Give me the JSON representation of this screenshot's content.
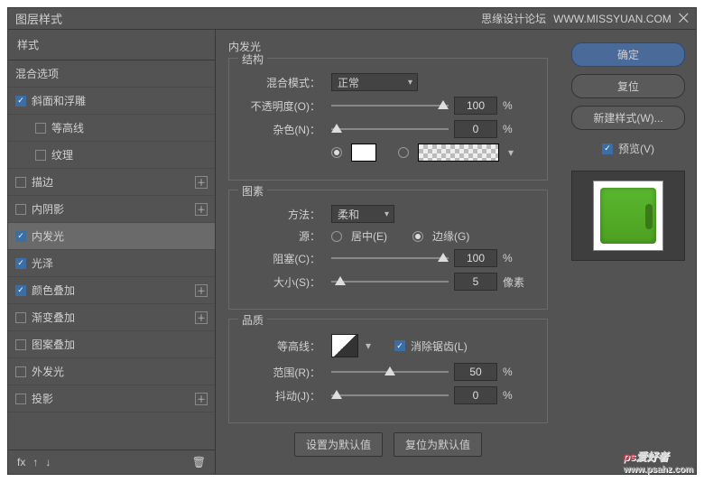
{
  "dialog": {
    "title": "图层样式",
    "watermark_site": "思缘设计论坛",
    "watermark_url": "WWW.MISSYUAN.COM"
  },
  "sidebar": {
    "header": "样式",
    "blend_options": "混合选项",
    "items": [
      {
        "label": "斜面和浮雕",
        "checked": true,
        "plus": false
      },
      {
        "label": "等高线",
        "checked": false,
        "plus": false,
        "indent": true
      },
      {
        "label": "纹理",
        "checked": false,
        "plus": false,
        "indent": true
      },
      {
        "label": "描边",
        "checked": false,
        "plus": true
      },
      {
        "label": "内阴影",
        "checked": false,
        "plus": true
      },
      {
        "label": "内发光",
        "checked": true,
        "plus": false,
        "selected": true
      },
      {
        "label": "光泽",
        "checked": true,
        "plus": false
      },
      {
        "label": "颜色叠加",
        "checked": true,
        "plus": true
      },
      {
        "label": "渐变叠加",
        "checked": false,
        "plus": true
      },
      {
        "label": "图案叠加",
        "checked": false,
        "plus": false
      },
      {
        "label": "外发光",
        "checked": false,
        "plus": false
      },
      {
        "label": "投影",
        "checked": false,
        "plus": true
      }
    ],
    "footer_fx": "fx"
  },
  "center": {
    "title": "内发光",
    "structure": {
      "title": "结构",
      "blend_mode_label": "混合模式：",
      "blend_mode_value": "正常",
      "opacity_label": "不透明度(O)：",
      "opacity_value": "100",
      "percent": "%",
      "noise_label": "杂色(N)：",
      "noise_value": "0"
    },
    "elements": {
      "title": "图素",
      "method_label": "方法：",
      "method_value": "柔和",
      "source_label": "源：",
      "source_center": "居中(E)",
      "source_edge": "边缘(G)",
      "choke_label": "阻塞(C)：",
      "choke_value": "100",
      "size_label": "大小(S)：",
      "size_value": "5",
      "pixels": "像素",
      "percent": "%"
    },
    "quality": {
      "title": "品质",
      "contour_label": "等高线：",
      "antialias_label": "消除锯齿(L)",
      "range_label": "范围(R)：",
      "range_value": "50",
      "jitter_label": "抖动(J)：",
      "jitter_value": "0",
      "percent": "%"
    },
    "buttons": {
      "make_default": "设置为默认值",
      "reset_default": "复位为默认值"
    }
  },
  "right": {
    "ok": "确定",
    "reset": "复位",
    "new_style": "新建样式(W)...",
    "preview": "预览(V)"
  },
  "watermark": {
    "ps": "ps",
    "text": "爱好者",
    "url": "www.psahz.com"
  }
}
